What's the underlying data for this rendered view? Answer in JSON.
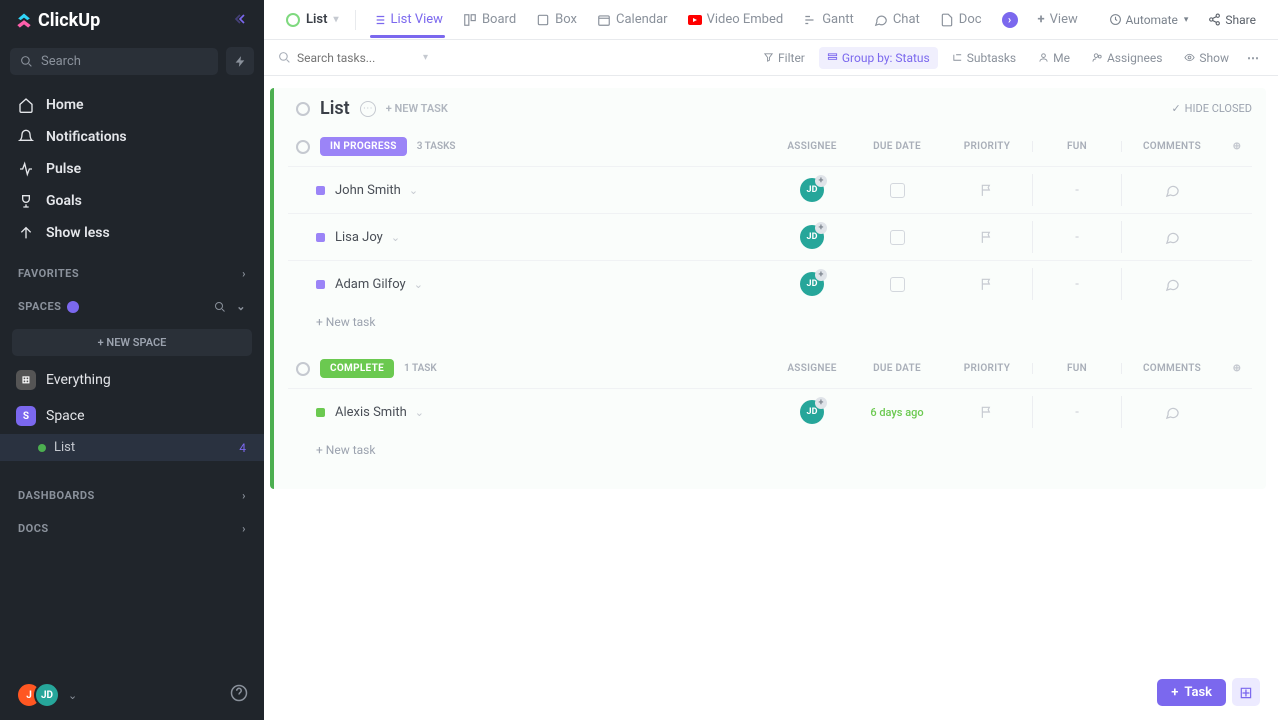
{
  "app": {
    "name": "ClickUp"
  },
  "sidebar": {
    "search_placeholder": "Search",
    "nav": [
      {
        "label": "Home"
      },
      {
        "label": "Notifications"
      },
      {
        "label": "Pulse"
      },
      {
        "label": "Goals"
      },
      {
        "label": "Show less"
      }
    ],
    "favorites_label": "FAVORITES",
    "spaces_label": "SPACES",
    "new_space": "+  NEW SPACE",
    "everything": "Everything",
    "space_name": "Space",
    "list_name": "List",
    "list_count": "4",
    "dashboards_label": "DASHBOARDS",
    "docs_label": "DOCS",
    "avatar1": "J",
    "avatar2": "JD"
  },
  "topbar": {
    "title": "List",
    "views": [
      {
        "label": "List View"
      },
      {
        "label": "Board"
      },
      {
        "label": "Box"
      },
      {
        "label": "Calendar"
      },
      {
        "label": "Video Embed"
      },
      {
        "label": "Gantt"
      },
      {
        "label": "Chat"
      },
      {
        "label": "Doc"
      }
    ],
    "add_view": "View",
    "automate": "Automate",
    "share": "Share"
  },
  "toolbar": {
    "search_placeholder": "Search tasks...",
    "filter": "Filter",
    "group_by": "Group by: Status",
    "subtasks": "Subtasks",
    "me": "Me",
    "assignees": "Assignees",
    "show": "Show"
  },
  "list": {
    "title": "List",
    "new_task_inline": "+ NEW TASK",
    "hide_closed": "HIDE CLOSED",
    "columns": {
      "assignee": "ASSIGNEE",
      "due": "DUE DATE",
      "priority": "PRIORITY",
      "fun": "FUN",
      "comments": "COMMENTS"
    },
    "groups": [
      {
        "status": "IN PROGRESS",
        "count": "3 TASKS",
        "kind": "inprog",
        "tasks": [
          {
            "name": "John Smith",
            "assignee": "JD",
            "due": "",
            "fun": "-"
          },
          {
            "name": "Lisa Joy",
            "assignee": "JD",
            "due": "",
            "fun": "-"
          },
          {
            "name": "Adam Gilfoy",
            "assignee": "JD",
            "due": "",
            "fun": "-"
          }
        ],
        "new_task": "+ New task"
      },
      {
        "status": "COMPLETE",
        "count": "1 TASK",
        "kind": "complete",
        "tasks": [
          {
            "name": "Alexis Smith",
            "assignee": "JD",
            "due": "6 days ago",
            "due_past": true,
            "fun": "-"
          }
        ],
        "new_task": "+ New task"
      }
    ]
  },
  "fab": {
    "task": "Task"
  }
}
